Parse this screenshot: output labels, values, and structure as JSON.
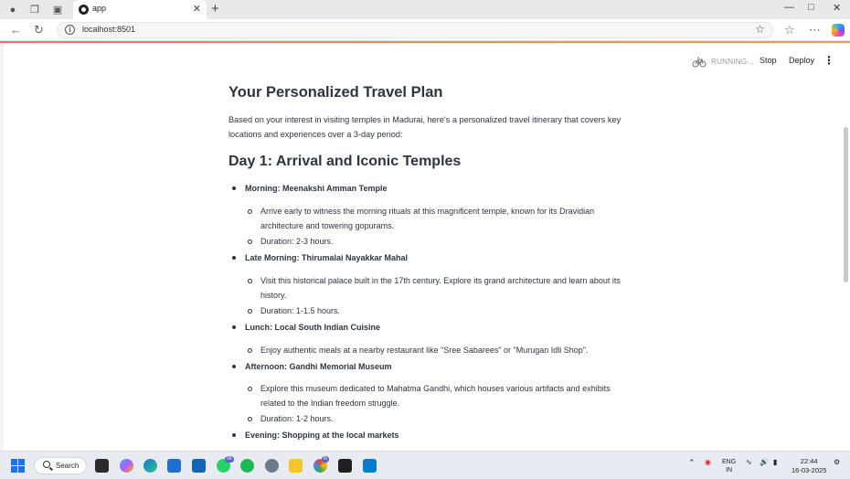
{
  "browser": {
    "tab_title": "app",
    "url": "localhost:8501"
  },
  "app_toolbar": {
    "running_label": "RUNNING...",
    "stop_label": "Stop",
    "deploy_label": "Deploy"
  },
  "content": {
    "title": "Your Personalized Travel Plan",
    "intro": "Based on your interest in visiting temples in Madurai, here's a personalized travel itinerary that covers key locations and experiences over a 3-day period:",
    "day_heading": "Day 1: Arrival and Iconic Temples",
    "items": [
      {
        "heading": "Morning: Meenakshi Amman Temple",
        "details": [
          "Arrive early to witness the morning rituals at this magnificent temple, known for its Dravidian architecture and towering gopurams.",
          "Duration: 2-3 hours."
        ]
      },
      {
        "heading": "Late Morning: Thirumalai Nayakkar Mahal",
        "details": [
          "Visit this historical palace built in the 17th century. Explore its grand architecture and learn about its history.",
          "Duration: 1-1.5 hours."
        ]
      },
      {
        "heading": "Lunch: Local South Indian Cuisine",
        "details": [
          "Enjoy authentic meals at a nearby restaurant like \"Sree Sabarees\" or \"Murugan Idli Shop\"."
        ]
      },
      {
        "heading": "Afternoon: Gandhi Memorial Museum",
        "details": [
          "Explore this museum dedicated to Mahatma Gandhi, which houses various artifacts and exhibits related to the Indian freedom struggle.",
          "Duration: 1-2 hours."
        ]
      },
      {
        "heading": "Evening: Shopping at the local markets",
        "details": []
      }
    ]
  },
  "taskbar": {
    "search_label": "Search",
    "badge_whatsapp": "99",
    "badge_chrome": "N",
    "lang_line1": "ENG",
    "lang_line2": "IN",
    "time": "22:44",
    "date": "16-03-2025"
  }
}
